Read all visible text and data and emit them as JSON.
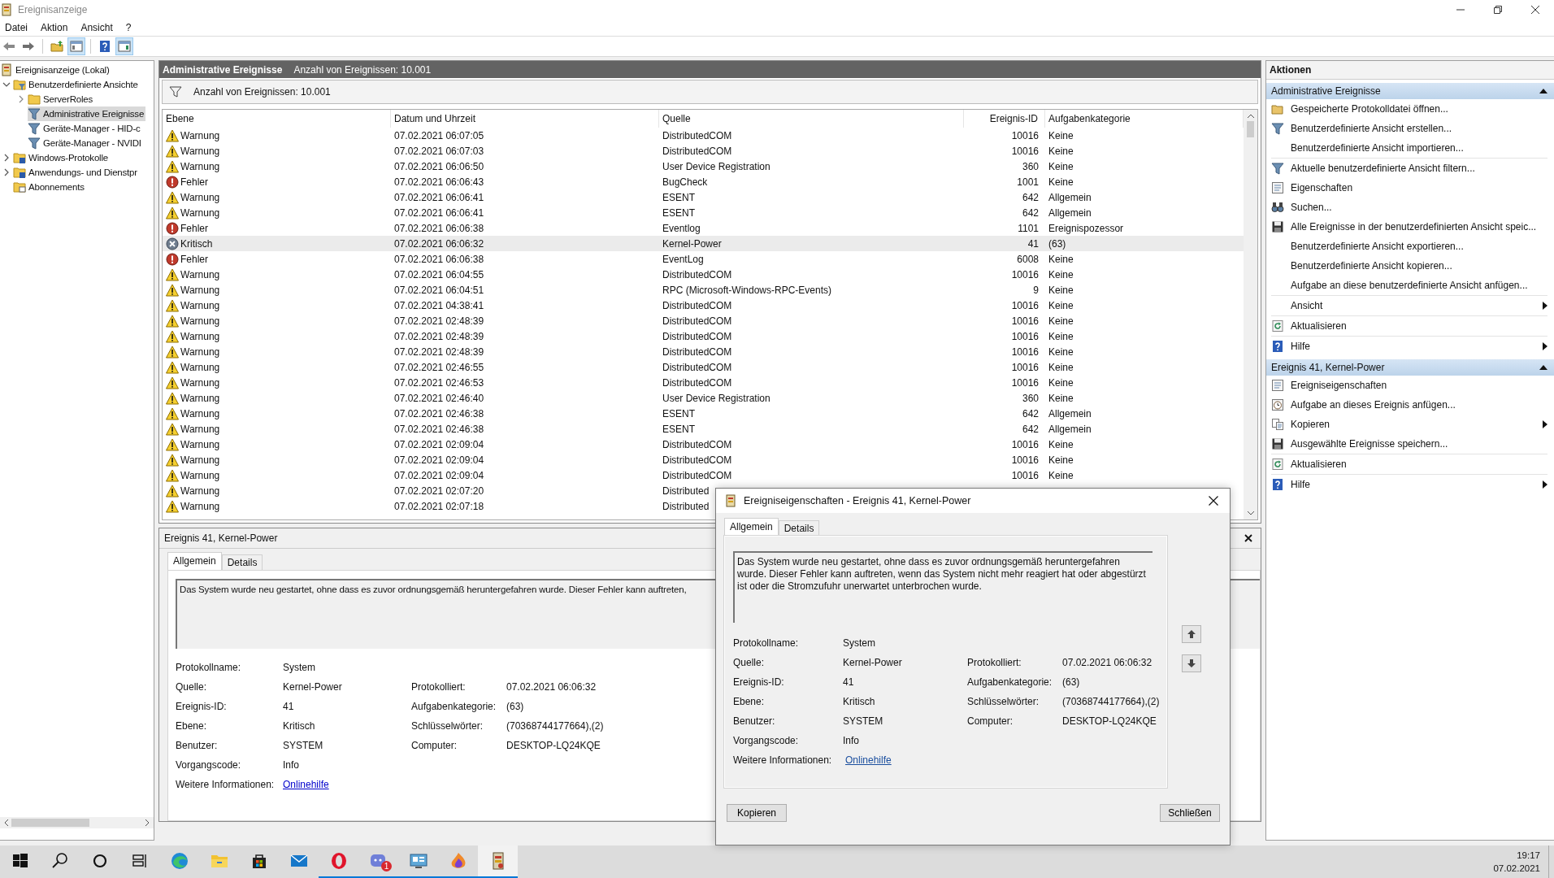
{
  "window": {
    "title": "Ereignisanzeige"
  },
  "menu": [
    "Datei",
    "Aktion",
    "Ansicht",
    "?"
  ],
  "toolbar": [
    {
      "kind": "back",
      "pressed": false
    },
    {
      "kind": "forward",
      "pressed": false
    },
    {
      "kind": "up",
      "pressed": false
    },
    {
      "kind": "tree",
      "pressed": true
    },
    {
      "kind": "help",
      "pressed": false
    },
    {
      "kind": "actions",
      "pressed": true
    }
  ],
  "tree": [
    {
      "label": "Ereignisanzeige (Lokal)",
      "kind": "log",
      "selected": false,
      "children": [
        {
          "label": "Benutzerdefinierte Ansichte",
          "kind": "folder-funnel",
          "expanded": true,
          "selected": false,
          "children": [
            {
              "label": "ServerRoles",
              "kind": "folder",
              "expanded": false,
              "selected": false
            },
            {
              "label": "Administrative Ereignisse",
              "kind": "funnel",
              "selected": true
            },
            {
              "label": "Geräte-Manager - HID-c",
              "kind": "funnel",
              "selected": false
            },
            {
              "label": "Geräte-Manager - NVIDI",
              "kind": "funnel",
              "selected": false
            }
          ]
        },
        {
          "label": "Windows-Protokolle",
          "kind": "folder-log",
          "expanded": false,
          "selected": false
        },
        {
          "label": "Anwendungs- und Dienstpr",
          "kind": "folder-log",
          "expanded": false,
          "selected": false
        },
        {
          "label": "Abonnements",
          "kind": "folder-sub",
          "selected": false
        }
      ]
    }
  ],
  "header": {
    "title": "Administrative Ereignisse",
    "count": "Anzahl von Ereignissen: 10.001"
  },
  "filter": {
    "text": "Anzahl von Ereignissen: 10.001"
  },
  "table": {
    "columns": [
      "Ebene",
      "Datum und Uhrzeit",
      "Quelle",
      "Ereignis-ID",
      "Aufgabenkategorie"
    ],
    "rows": [
      {
        "kind": "warning",
        "level": "Warnung",
        "date": "07.02.2021 06:07:05",
        "source": "DistributedCOM",
        "id": "10016",
        "category": "Keine",
        "selected": false
      },
      {
        "kind": "warning",
        "level": "Warnung",
        "date": "07.02.2021 06:07:03",
        "source": "DistributedCOM",
        "id": "10016",
        "category": "Keine",
        "selected": false
      },
      {
        "kind": "warning",
        "level": "Warnung",
        "date": "07.02.2021 06:06:50",
        "source": "User Device Registration",
        "id": "360",
        "category": "Keine",
        "selected": false
      },
      {
        "kind": "error",
        "level": "Fehler",
        "date": "07.02.2021 06:06:43",
        "source": "BugCheck",
        "id": "1001",
        "category": "Keine",
        "selected": false
      },
      {
        "kind": "warning",
        "level": "Warnung",
        "date": "07.02.2021 06:06:41",
        "source": "ESENT",
        "id": "642",
        "category": "Allgemein",
        "selected": false
      },
      {
        "kind": "warning",
        "level": "Warnung",
        "date": "07.02.2021 06:06:41",
        "source": "ESENT",
        "id": "642",
        "category": "Allgemein",
        "selected": false
      },
      {
        "kind": "error",
        "level": "Fehler",
        "date": "07.02.2021 06:06:38",
        "source": "Eventlog",
        "id": "1101",
        "category": "Ereignispozessor",
        "selected": false
      },
      {
        "kind": "critical",
        "level": "Kritisch",
        "date": "07.02.2021 06:06:32",
        "source": "Kernel-Power",
        "id": "41",
        "category": "(63)",
        "selected": true
      },
      {
        "kind": "error",
        "level": "Fehler",
        "date": "07.02.2021 06:06:38",
        "source": "EventLog",
        "id": "6008",
        "category": "Keine",
        "selected": false
      },
      {
        "kind": "warning",
        "level": "Warnung",
        "date": "07.02.2021 06:04:55",
        "source": "DistributedCOM",
        "id": "10016",
        "category": "Keine",
        "selected": false
      },
      {
        "kind": "warning",
        "level": "Warnung",
        "date": "07.02.2021 06:04:51",
        "source": "RPC (Microsoft-Windows-RPC-Events)",
        "id": "9",
        "category": "Keine",
        "selected": false
      },
      {
        "kind": "warning",
        "level": "Warnung",
        "date": "07.02.2021 04:38:41",
        "source": "DistributedCOM",
        "id": "10016",
        "category": "Keine",
        "selected": false
      },
      {
        "kind": "warning",
        "level": "Warnung",
        "date": "07.02.2021 02:48:39",
        "source": "DistributedCOM",
        "id": "10016",
        "category": "Keine",
        "selected": false
      },
      {
        "kind": "warning",
        "level": "Warnung",
        "date": "07.02.2021 02:48:39",
        "source": "DistributedCOM",
        "id": "10016",
        "category": "Keine",
        "selected": false
      },
      {
        "kind": "warning",
        "level": "Warnung",
        "date": "07.02.2021 02:48:39",
        "source": "DistributedCOM",
        "id": "10016",
        "category": "Keine",
        "selected": false
      },
      {
        "kind": "warning",
        "level": "Warnung",
        "date": "07.02.2021 02:46:55",
        "source": "DistributedCOM",
        "id": "10016",
        "category": "Keine",
        "selected": false
      },
      {
        "kind": "warning",
        "level": "Warnung",
        "date": "07.02.2021 02:46:53",
        "source": "DistributedCOM",
        "id": "10016",
        "category": "Keine",
        "selected": false
      },
      {
        "kind": "warning",
        "level": "Warnung",
        "date": "07.02.2021 02:46:40",
        "source": "User Device Registration",
        "id": "360",
        "category": "Keine",
        "selected": false
      },
      {
        "kind": "warning",
        "level": "Warnung",
        "date": "07.02.2021 02:46:38",
        "source": "ESENT",
        "id": "642",
        "category": "Allgemein",
        "selected": false
      },
      {
        "kind": "warning",
        "level": "Warnung",
        "date": "07.02.2021 02:46:38",
        "source": "ESENT",
        "id": "642",
        "category": "Allgemein",
        "selected": false
      },
      {
        "kind": "warning",
        "level": "Warnung",
        "date": "07.02.2021 02:09:04",
        "source": "DistributedCOM",
        "id": "10016",
        "category": "Keine",
        "selected": false
      },
      {
        "kind": "warning",
        "level": "Warnung",
        "date": "07.02.2021 02:09:04",
        "source": "DistributedCOM",
        "id": "10016",
        "category": "Keine",
        "selected": false
      },
      {
        "kind": "warning",
        "level": "Warnung",
        "date": "07.02.2021 02:09:04",
        "source": "DistributedCOM",
        "id": "10016",
        "category": "Keine",
        "selected": false
      },
      {
        "kind": "warning",
        "level": "Warnung",
        "date": "07.02.2021 02:07:20",
        "source": "Distributed",
        "selected": false
      },
      {
        "kind": "warning",
        "level": "Warnung",
        "date": "07.02.2021 02:07:18",
        "source": "Distributed",
        "selected": false
      }
    ]
  },
  "details": {
    "title": "Ereignis 41, Kernel-Power",
    "tabs": [
      {
        "label": "Allgemein",
        "selected": true
      },
      {
        "label": "Details",
        "selected": false
      }
    ],
    "description": "Das System wurde neu gestartet, ohne dass es zuvor ordnungsgemäß heruntergefahren wurde. Dieser Fehler kann auftreten,",
    "rows": [
      {
        "left": {
          "label": "Protokollname:",
          "value": "System"
        }
      },
      {
        "left": {
          "label": "Quelle:",
          "value": "Kernel-Power"
        },
        "right": {
          "label": "Protokolliert:",
          "value": "07.02.2021 06:06:32"
        }
      },
      {
        "left": {
          "label": "Ereignis-ID:",
          "value": "41"
        },
        "right": {
          "label": "Aufgabenkategorie:",
          "value": "(63)"
        }
      },
      {
        "left": {
          "label": "Ebene:",
          "value": "Kritisch"
        },
        "right": {
          "label": "Schlüsselwörter:",
          "value": "(70368744177664),(2)"
        }
      },
      {
        "left": {
          "label": "Benutzer:",
          "value": "SYSTEM"
        },
        "right": {
          "label": "Computer:",
          "value": "DESKTOP-LQ24KQE"
        }
      },
      {
        "left": {
          "label": "Vorgangscode:",
          "value": "Info"
        }
      },
      {
        "left": {
          "label": "Weitere Informationen:",
          "link": "Onlinehilfe"
        }
      }
    ]
  },
  "actions": {
    "title": "Aktionen",
    "sections": [
      {
        "title": "Administrative Ereignisse",
        "expanded": true,
        "groups": [
          [
            {
              "label": "Gespeicherte Protokolldatei öffnen...",
              "kind": "folder",
              "submenu": false
            },
            {
              "label": "Benutzerdefinierte Ansicht erstellen...",
              "kind": "funnel",
              "submenu": false
            },
            {
              "label": "Benutzerdefinierte Ansicht importieren...",
              "kind": "blank",
              "submenu": false
            }
          ],
          [
            {
              "label": "Aktuelle benutzerdefinierte Ansicht filtern...",
              "kind": "funnel",
              "submenu": false
            },
            {
              "label": "Eigenschaften",
              "kind": "properties",
              "submenu": false
            },
            {
              "label": "Suchen...",
              "kind": "binoculars",
              "submenu": false
            },
            {
              "label": "Alle Ereignisse in der benutzerdefinierten Ansicht speic...",
              "kind": "disk",
              "submenu": false
            },
            {
              "label": "Benutzerdefinierte Ansicht exportieren...",
              "kind": "blank",
              "submenu": false
            },
            {
              "label": "Benutzerdefinierte Ansicht kopieren...",
              "kind": "blank",
              "submenu": false
            },
            {
              "label": "Aufgabe an diese benutzerdefinierte Ansicht anfügen...",
              "kind": "blank",
              "submenu": false
            }
          ],
          [
            {
              "label": "Ansicht",
              "kind": "blank",
              "submenu": true
            }
          ],
          [
            {
              "label": "Aktualisieren",
              "kind": "refresh",
              "submenu": false
            }
          ],
          [
            {
              "label": "Hilfe",
              "kind": "help",
              "submenu": true
            }
          ]
        ]
      },
      {
        "title": "Ereignis 41, Kernel-Power",
        "expanded": true,
        "groups": [
          [
            {
              "label": "Ereigniseigenschaften",
              "kind": "properties",
              "submenu": false
            },
            {
              "label": "Aufgabe an dieses Ereignis anfügen...",
              "kind": "task",
              "submenu": false
            },
            {
              "label": "Kopieren",
              "kind": "copy",
              "submenu": true
            },
            {
              "label": "Ausgewählte Ereignisse speichern...",
              "kind": "disk",
              "submenu": false
            }
          ],
          [
            {
              "label": "Aktualisieren",
              "kind": "refresh",
              "submenu": false
            }
          ],
          [
            {
              "label": "Hilfe",
              "kind": "help",
              "submenu": true
            }
          ]
        ]
      }
    ]
  },
  "dialog": {
    "title": "Ereigniseigenschaften - Ereignis 41, Kernel-Power",
    "tabs": [
      {
        "label": "Allgemein",
        "selected": true
      },
      {
        "label": "Details",
        "selected": false
      }
    ],
    "description": "Das System wurde neu gestartet, ohne dass es zuvor ordnungsgemäß heruntergefahren wurde. Dieser Fehler kann auftreten, wenn das System nicht mehr reagiert hat oder abgestürzt ist oder die Stromzufuhr unerwartet unterbrochen wurde.",
    "rows": [
      {
        "left": {
          "label": "Protokollname:",
          "value": "System"
        }
      },
      {
        "left": {
          "label": "Quelle:",
          "value": "Kernel-Power"
        },
        "right": {
          "label": "Protokolliert:",
          "value": "07.02.2021 06:06:32"
        }
      },
      {
        "left": {
          "label": "Ereignis-ID:",
          "value": "41"
        },
        "right": {
          "label": "Aufgabenkategorie:",
          "value": "(63)"
        }
      },
      {
        "left": {
          "label": "Ebene:",
          "value": "Kritisch"
        },
        "right": {
          "label": "Schlüsselwörter:",
          "value": "(70368744177664),(2)"
        }
      },
      {
        "left": {
          "label": "Benutzer:",
          "value": "SYSTEM"
        },
        "right": {
          "label": "Computer:",
          "value": "DESKTOP-LQ24KQE"
        }
      },
      {
        "left": {
          "label": "Vorgangscode:",
          "value": "Info"
        }
      },
      {
        "left": {
          "label": "Weitere Informationen:",
          "link": "Onlinehilfe"
        }
      }
    ],
    "buttons": [
      "Kopieren",
      "Schließen"
    ]
  },
  "taskbar": {
    "apps": [
      {
        "kind": "start",
        "running": false,
        "active": false
      },
      {
        "kind": "search",
        "running": false,
        "active": false
      },
      {
        "kind": "cortana",
        "running": false,
        "active": false
      },
      {
        "kind": "taskview",
        "running": false,
        "active": false
      },
      {
        "kind": "browser",
        "running": false,
        "active": false
      },
      {
        "kind": "explorer",
        "running": false,
        "active": false
      },
      {
        "kind": "store",
        "running": false,
        "active": false
      },
      {
        "kind": "mail",
        "running": false,
        "active": false
      },
      {
        "kind": "opera",
        "running": true,
        "active": false
      },
      {
        "kind": "chat",
        "running": true,
        "active": false,
        "badge": "1"
      },
      {
        "kind": "monitor",
        "running": true,
        "active": false
      },
      {
        "kind": "flame",
        "running": true,
        "active": false
      },
      {
        "kind": "eventlog",
        "running": true,
        "active": true
      }
    ],
    "time": "19:17",
    "date": "07.02.2021"
  }
}
